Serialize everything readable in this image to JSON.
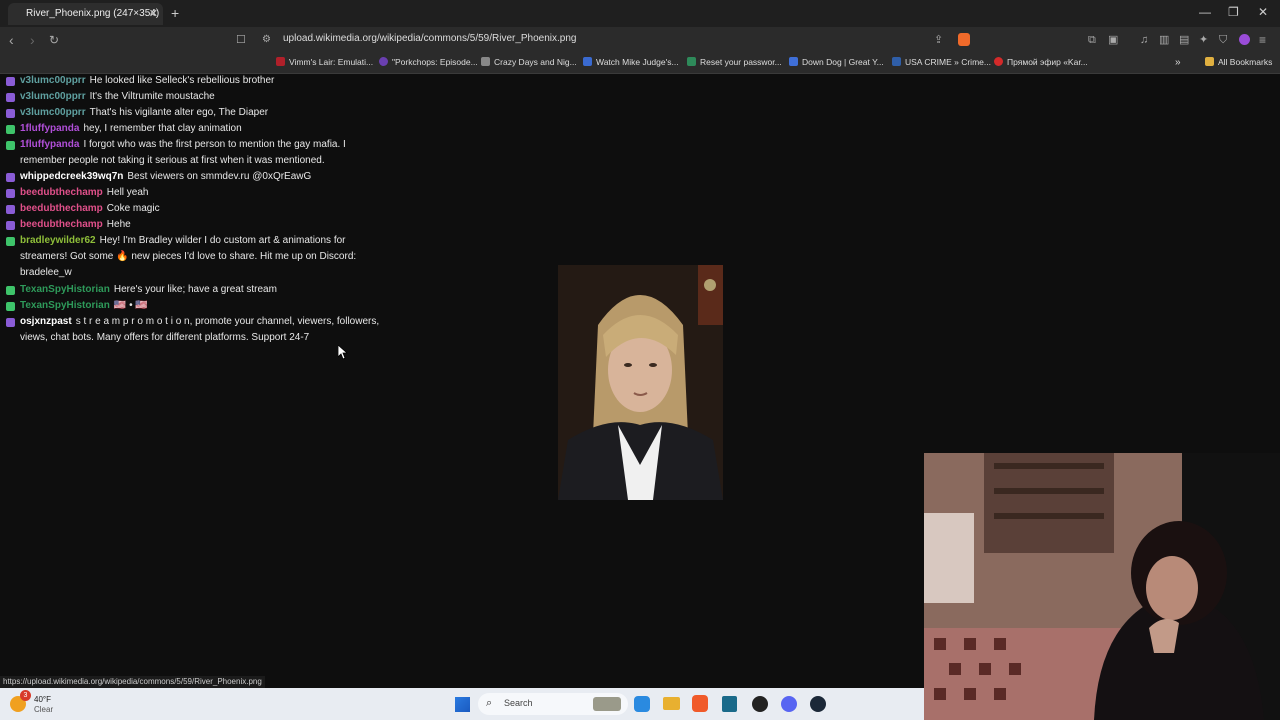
{
  "browser": {
    "tab_title": "River_Phoenix.png (247×354)",
    "tab_close": "✕",
    "new_tab": "+",
    "window_controls": [
      "—",
      "❐",
      "✕"
    ],
    "url": "upload.wikimedia.org/wikipedia/commons/5/59/River_Phoenix.png",
    "status_url": "https://upload.wikimedia.org/wikipedia/commons/5/59/River_Phoenix.png",
    "bookmarks": [
      {
        "label": "Vimm's Lair: Emulati...",
        "color": "#b0202a"
      },
      {
        "label": "\"Porkchops: Episode...",
        "color": "#6a3fb0"
      },
      {
        "label": "Crazy Days and Nig...",
        "color": "#888888"
      },
      {
        "label": "Watch Mike Judge's...",
        "color": "#3a6ad0"
      },
      {
        "label": "Reset your passwor...",
        "color": "#2e8a5a"
      },
      {
        "label": "Down Dog | Great Y...",
        "color": "#3f6fd8"
      },
      {
        "label": "USA CRIME » Crime...",
        "color": "#2f5ea8"
      },
      {
        "label": "Прямой эфир «Kar...",
        "color": "#d42a2a"
      }
    ],
    "all_bookmarks": "All Bookmarks"
  },
  "chat": {
    "messages": [
      {
        "user": "v3lumc00pprr",
        "color": "#5fa0a0",
        "text": "He looked like Selleck's rebellious brother",
        "badge": "purple"
      },
      {
        "user": "v3lumc00pprr",
        "color": "#5fa0a0",
        "text": "It's the Viltrumite moustache",
        "badge": "purple"
      },
      {
        "user": "v3lumc00pprr",
        "color": "#5fa0a0",
        "text": "That's his vigilante alter ego, The Diaper",
        "badge": "purple"
      },
      {
        "user": "1fluffypanda",
        "color": "#b04fd8",
        "text": "hey, I remember that clay animation",
        "badge": "green"
      },
      {
        "user": "1fluffypanda",
        "color": "#b04fd8",
        "text": "I forgot who was the first person to mention the gay mafia. I remember people not taking it serious at first when it was mentioned.",
        "badge": "green"
      },
      {
        "user": "whippedcreek39wq7n",
        "color": "#ffffff",
        "text": "Best viewers on smmdev.ru @0xQrEawG",
        "badge": "purple"
      },
      {
        "user": "beedubthechamp",
        "color": "#e0508a",
        "text": "Hell yeah",
        "badge": "purple"
      },
      {
        "user": "beedubthechamp",
        "color": "#e0508a",
        "text": "Coke magic",
        "badge": "purple"
      },
      {
        "user": "beedubthechamp",
        "color": "#e0508a",
        "text": "Hehe",
        "badge": "purple"
      },
      {
        "user": "bradleywilder62",
        "color": "#8fbf3a",
        "text": "Hey! I'm Bradley wilder I do custom art & animations for streamers! Got some 🔥 new pieces I'd love to share. Hit me up on Discord: bradelee_w",
        "badge": "green"
      },
      {
        "user": "TexanSpyHistorian",
        "color": "#2e9a5a",
        "text": "Here's your like; have a great stream",
        "badge": "green"
      },
      {
        "user": "TexanSpyHistorian",
        "color": "#2e9a5a",
        "text": "🇺🇸 • 🇺🇸",
        "badge": "green"
      },
      {
        "user": "osjxnzpast",
        "color": "#ffffff",
        "text": "s t r e a m p r o m o t i o n, promote your channel, viewers, followers, views, chat bots. Many offers for different platforms. Support 24-7",
        "badge": "purple"
      }
    ]
  },
  "taskbar": {
    "weather_temp": "40°F",
    "weather_desc": "Clear",
    "search_placeholder": "Search",
    "notification_count": "3"
  },
  "colors": {
    "green_badge": "#3ec46a",
    "purple_badge": "#8a5cd6"
  }
}
